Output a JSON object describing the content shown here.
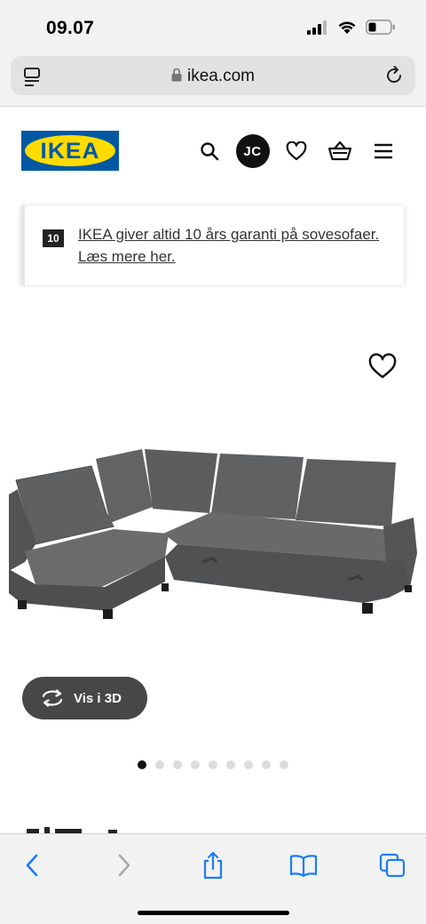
{
  "status_bar": {
    "time": "09.07"
  },
  "browser": {
    "url": "ikea.com"
  },
  "header": {
    "logo_text": "IKEA",
    "avatar_initials": "JC"
  },
  "banner": {
    "badge": "10",
    "text": "IKEA giver altid 10 års garanti på sovesofaer. Læs mere her."
  },
  "product": {
    "view3d_label": "Vis i 3D",
    "carousel": {
      "count": 9,
      "active_index": 0
    },
    "sofa_color": "#5a5b5d"
  },
  "colors": {
    "ikea_blue": "#0058a3",
    "ikea_yellow": "#ffdb00",
    "ios_blue": "#1a7cf5"
  }
}
